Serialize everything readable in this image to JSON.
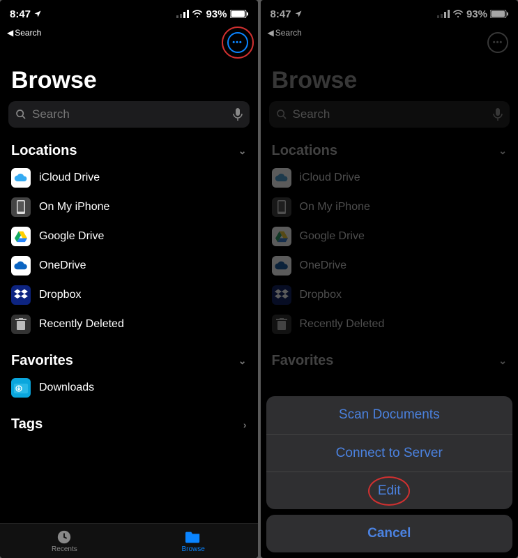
{
  "status": {
    "time": "8:47",
    "battery": "93%"
  },
  "back_label": "Search",
  "title": "Browse",
  "search": {
    "placeholder": "Search"
  },
  "sections": {
    "locations": {
      "title": "Locations"
    },
    "favorites": {
      "title": "Favorites"
    },
    "tags": {
      "title": "Tags"
    }
  },
  "locations": [
    {
      "label": "iCloud Drive",
      "icon": "icloud"
    },
    {
      "label": "On My iPhone",
      "icon": "phone"
    },
    {
      "label": "Google Drive",
      "icon": "gdrive"
    },
    {
      "label": "OneDrive",
      "icon": "onedrive"
    },
    {
      "label": "Dropbox",
      "icon": "dropbox"
    },
    {
      "label": "Recently Deleted",
      "icon": "trash"
    }
  ],
  "favorites": [
    {
      "label": "Downloads",
      "icon": "downloads"
    }
  ],
  "tabs": {
    "recents": "Recents",
    "browse": "Browse"
  },
  "sheet": {
    "scan": "Scan Documents",
    "connect": "Connect to Server",
    "edit": "Edit",
    "cancel": "Cancel"
  }
}
